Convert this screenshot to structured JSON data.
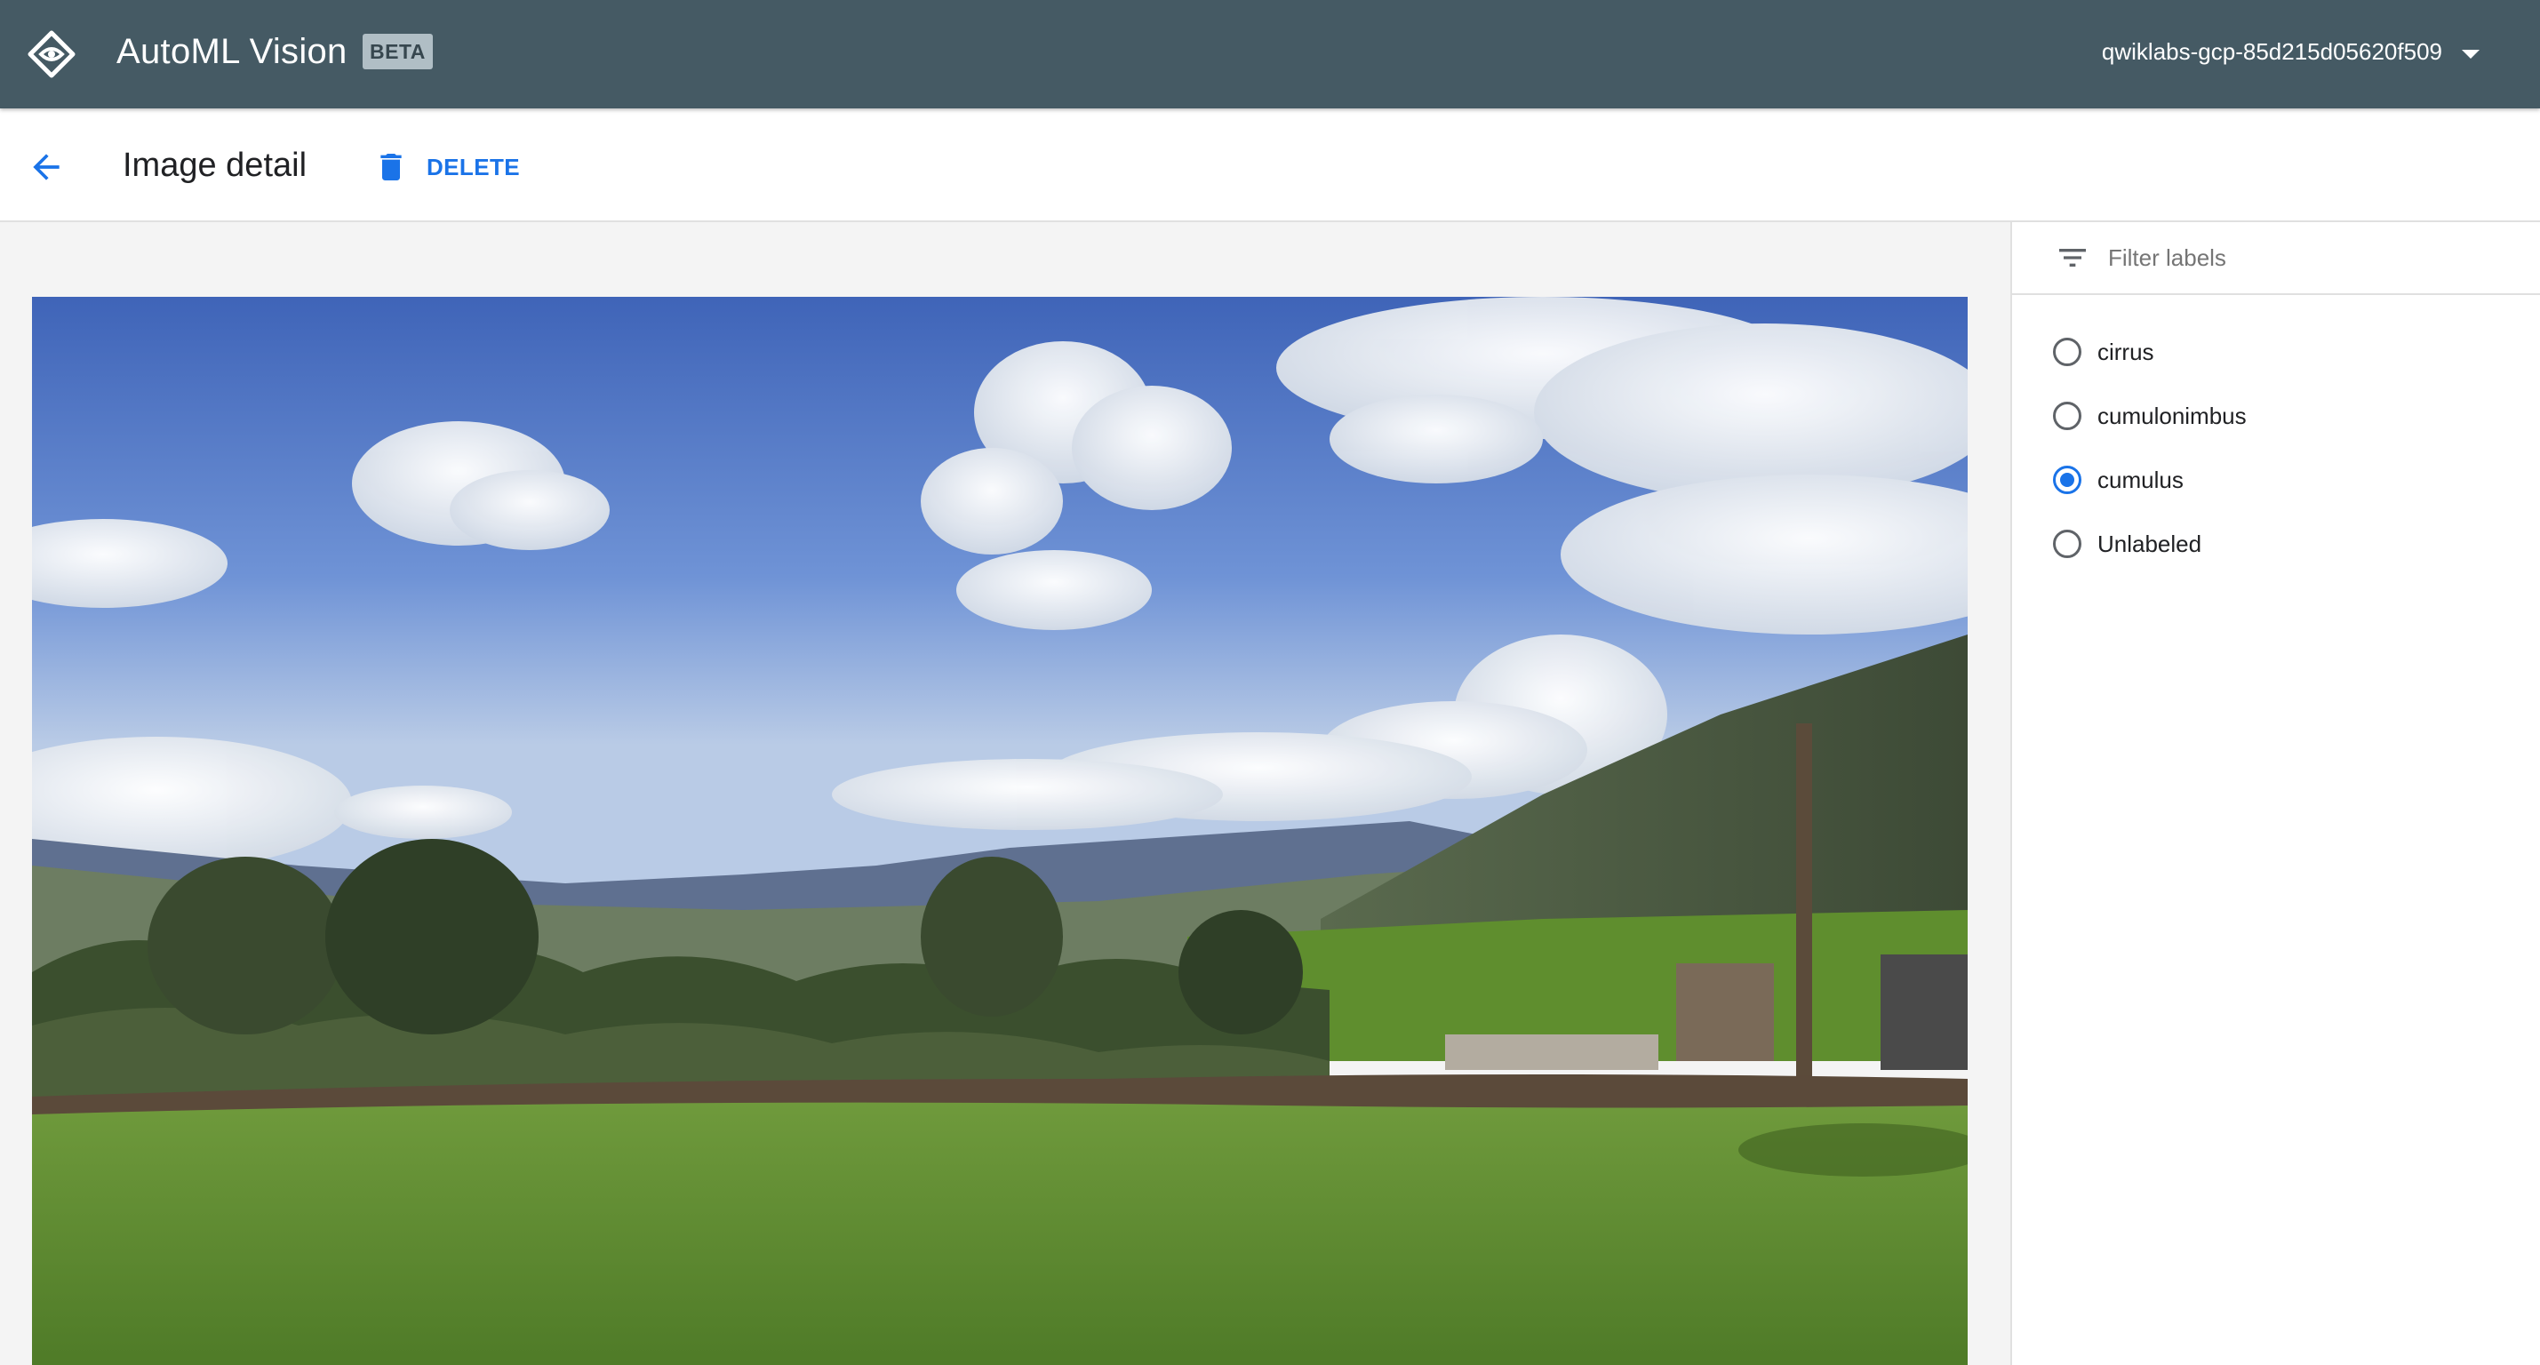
{
  "app": {
    "product_name": "AutoML Vision",
    "badge": "BETA",
    "project": "qwiklabs-gcp-85d215d05620f509",
    "colors": {
      "appbar": "#455a64",
      "accent": "#1a73e8"
    }
  },
  "toolbar": {
    "back_icon": "arrow-back-icon",
    "title": "Image detail",
    "delete_label": "DELETE",
    "delete_icon": "trash-icon"
  },
  "image": {
    "description_icon": "photo"
  },
  "labels_panel": {
    "filter_placeholder": "Filter labels",
    "filter_icon": "filter-list-icon",
    "items": [
      {
        "label": "cirrus",
        "selected": false
      },
      {
        "label": "cumulonimbus",
        "selected": false
      },
      {
        "label": "cumulus",
        "selected": true
      },
      {
        "label": "Unlabeled",
        "selected": false
      }
    ]
  }
}
